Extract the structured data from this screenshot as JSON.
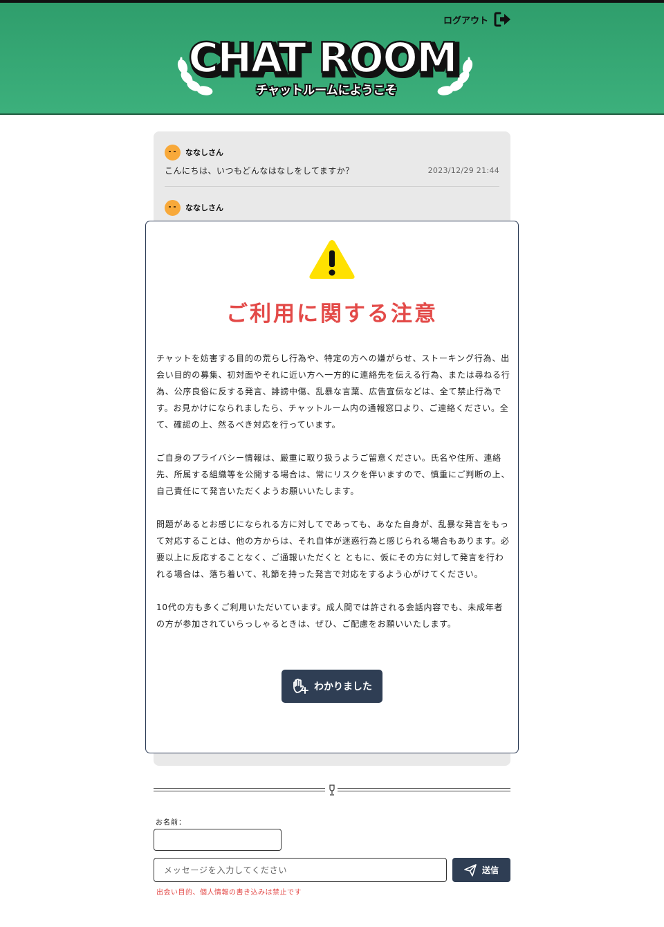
{
  "header": {
    "logout_label": "ログアウト",
    "logo_title": "CHAT ROOM",
    "logo_subtitle": "チャットルームにようこそ"
  },
  "messages": [
    {
      "user": "ななしさん",
      "text": "こんにちは、いつもどんなはなしをしてますか？",
      "time": "2023/12/29 21:44"
    },
    {
      "user": "ななしさん",
      "text": "",
      "time": ""
    }
  ],
  "modal": {
    "title": "ご利用に関する注意",
    "paragraphs": [
      "チャットを妨害する目的の荒らし行為や、特定の方への嫌がらせ、ストーキング行為、出会い目的の募集、初対面やそれに近い方へ一方的に連絡先を伝える行為、または尋ねる行為、公序良俗に反する発言、誹謗中傷、乱暴な言葉、広告宣伝などは、全て禁止行為です。お見かけになられましたら、チャットルーム内の通報窓口より、ご連絡ください。全て、確認の上、然るべき対応を行っています。",
      "ご自身のプライバシー情報は、厳重に取り扱うようご留意ください。氏名や住所、連絡先、所属する組織等を公開する場合は、常にリスクを伴いますので、慎重にご判断の上、自己責任にて発言いただくようお願いいたします。",
      "問題があるとお感じになられる方に対してであっても、あなた自身が、乱暴な発言をもって対応することは、他の方からは、それ自体が迷惑行為と感じられる場合もあります。必要以上に反応することなく、ご通報いただくと ともに、仮にその方に対して発言を行われる場合は、落ち着いて、礼節を持った発言で対応をするよう心がけてください。",
      "10代の方も多くご利用いただいています。成人間では許される会話内容でも、未成年者の方が参加されていらっしゃるときは、ぜひ、ご配慮をお願いいたします。"
    ],
    "ok_label": "わかりました"
  },
  "form": {
    "name_label": "お名前：",
    "name_value": "",
    "message_placeholder": "メッセージを入力してください",
    "send_label": "送信",
    "notice": "出会い目的、個人情報の書き込みは禁止です"
  },
  "colors": {
    "header_green": "#3cb07c",
    "accent_red": "#e34a48",
    "button_navy": "#2f3e54",
    "warning_yellow": "#ffe100",
    "avatar_orange": "#f8a93a"
  },
  "icons": [
    "logout-icon",
    "warning-icon",
    "hand-icon",
    "send-icon",
    "wine-glass-icon"
  ]
}
